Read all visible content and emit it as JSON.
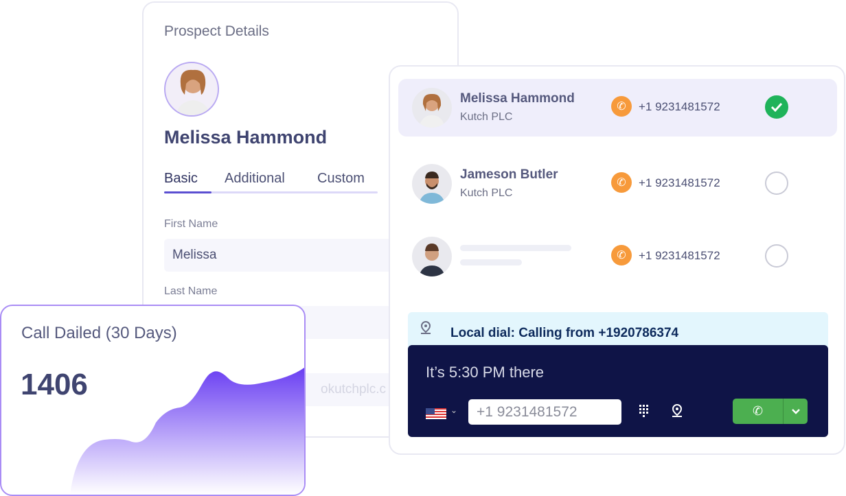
{
  "prospect": {
    "title": "Prospect Details",
    "name": "Melissa Hammond",
    "tabs": [
      {
        "label": "Basic",
        "active": true
      },
      {
        "label": "Additional"
      },
      {
        "label": "Custom"
      }
    ],
    "fields": [
      {
        "label": "First Name",
        "value": "Melissa"
      },
      {
        "label": "Last Name",
        "value": ""
      },
      {
        "label": "",
        "value": "okutchplc.c"
      }
    ]
  },
  "contacts": [
    {
      "name": "Melissa Hammond",
      "company": "Kutch PLC",
      "phone": "+1 9231481572",
      "selected": true
    },
    {
      "name": "Jameson Butler",
      "company": "Kutch PLC",
      "phone": "+1 9231481572",
      "selected": false
    },
    {
      "name": "",
      "company": "",
      "phone": "+1 9231481572",
      "selected": false
    }
  ],
  "local_dial": "Local dial: Calling from +1920786374",
  "dialer": {
    "time_text": "It’s 5:30 PM there",
    "number": "+1 9231481572",
    "country": "US"
  },
  "stats": {
    "title": "Call Dailed",
    "period": "(30 Days)",
    "value": "1406"
  },
  "colors": {
    "accent": "#5b4fd1",
    "call": "#4caf50",
    "panel": "#0f1447",
    "phone_icon": "#f79a3b",
    "check": "#1fb35a"
  }
}
